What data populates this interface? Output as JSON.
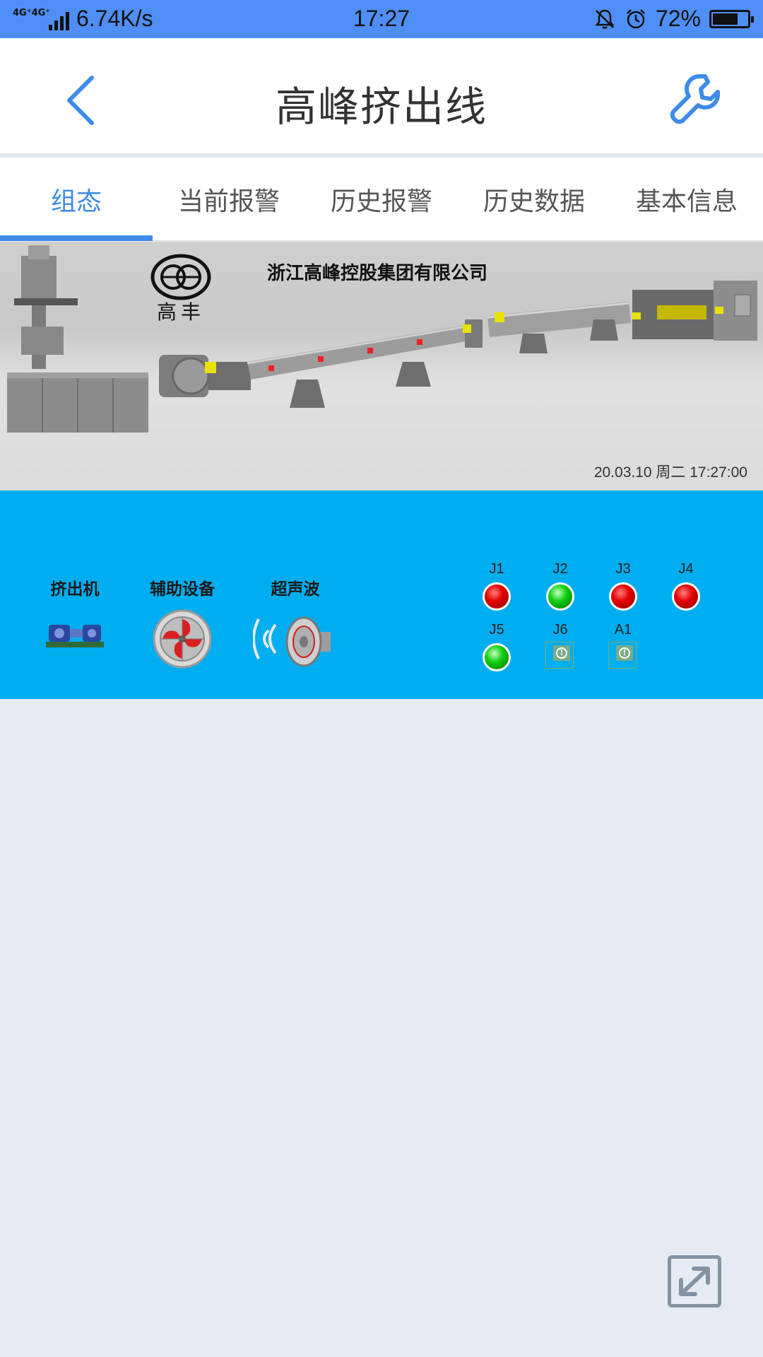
{
  "status_bar": {
    "network": "4G⁺4G⁺",
    "speed": "6.74K/s",
    "time": "17:27",
    "battery": "72%",
    "battery_level": 0.72
  },
  "header": {
    "title": "高峰挤出线",
    "back_icon": "chevron-left-icon",
    "settings_icon": "wrench-icon",
    "accent_color": "#3f8be8"
  },
  "tabs": [
    {
      "label": "组态",
      "active": true
    },
    {
      "label": "当前报警",
      "active": false
    },
    {
      "label": "历史报警",
      "active": false
    },
    {
      "label": "历史数据",
      "active": false
    },
    {
      "label": "基本信息",
      "active": false
    }
  ],
  "banner": {
    "company": "浙江高峰控股集团有限公司",
    "logo_text": "高丰",
    "datetime": "20.03.10 周二 17:27:00"
  },
  "panel": {
    "background": "#00adef",
    "equipment": [
      {
        "label": "挤出机",
        "icon": "pump-motor-icon"
      },
      {
        "label": "辅助设备",
        "icon": "fan-icon"
      },
      {
        "label": "超声波",
        "icon": "speaker-icon"
      }
    ],
    "indicators": [
      {
        "label": "J1",
        "state": "red"
      },
      {
        "label": "J2",
        "state": "green"
      },
      {
        "label": "J3",
        "state": "red"
      },
      {
        "label": "J4",
        "state": "red"
      },
      {
        "label": "J5",
        "state": "green"
      },
      {
        "label": "J6",
        "state": "unknown"
      },
      {
        "label": "A1",
        "state": "unknown"
      }
    ]
  },
  "expand_icon": "expand-arrows-icon"
}
